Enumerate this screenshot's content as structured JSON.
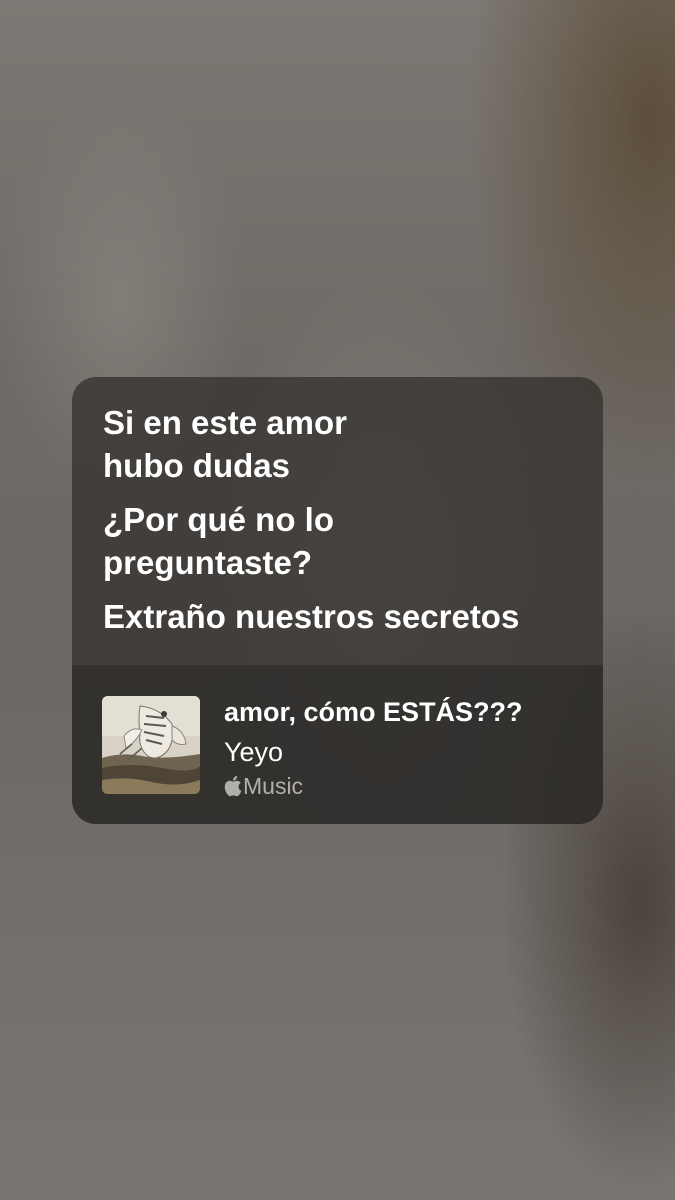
{
  "lyrics": {
    "lines": [
      "Si en este amor hubo dudas",
      "¿Por qué no lo preguntaste?",
      "Extraño nuestros secretos"
    ]
  },
  "song": {
    "title": "amor, cómo ESTÁS???",
    "artist": "Yeyo",
    "service": "Music",
    "artwork_icon": "album-artwork"
  },
  "colors": {
    "card_bg": "#343230",
    "text": "#ffffff",
    "service_text": "#dcdad7"
  }
}
